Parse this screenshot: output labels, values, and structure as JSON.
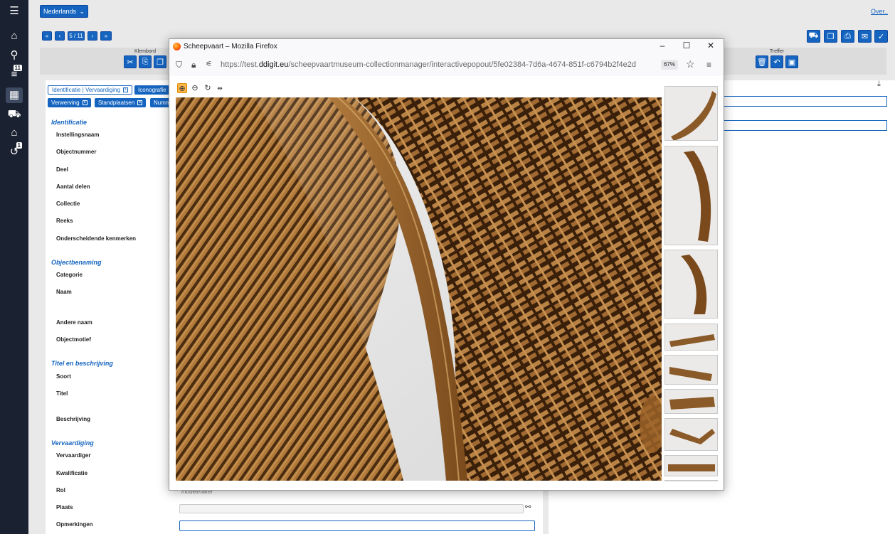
{
  "topbar": {
    "language": "Nederlands",
    "over_link": "Over.."
  },
  "leftnav": {
    "badge_list": "11",
    "badge_history": "1"
  },
  "pager": {
    "first": "«",
    "prev": "‹",
    "position": "5 / 11",
    "next": "›",
    "last": "»"
  },
  "toolbar": {
    "klembord_label": "Klembord",
    "treffer_label": "Treffer"
  },
  "tabs": {
    "row1": [
      {
        "label": "Identificatie | Vervaardiging",
        "active": false
      },
      {
        "label": "Iconografie",
        "active": true
      }
    ],
    "row2": [
      {
        "label": "Verwerving",
        "active": true
      },
      {
        "label": "Standplaatsen",
        "active": true
      },
      {
        "label": "Numm",
        "active": true
      }
    ]
  },
  "form": {
    "sec_identificatie": "Identificatie",
    "instellingsnaam": "Instellingsnaam",
    "objectnummer": "Objectnummer",
    "deel": "Deel",
    "aantal_delen": "Aantal delen",
    "collectie": "Collectie",
    "reeks": "Reeks",
    "onderscheidende": "Onderscheidende kenmerken",
    "sec_objectbenaming": "Objectbenaming",
    "categorie": "Categorie",
    "naam": "Naam",
    "andere_naam": "Andere naam",
    "objectmotief": "Objectmotief",
    "sec_titel": "Titel en beschrijving",
    "soort": "Soort",
    "titel": "Titel",
    "beschrijving": "Beschrijving",
    "sec_vervaardiging": "Vervaardiging",
    "vervaardiger": "Vervaardiger",
    "kwalificatie": "Kwalificatie",
    "rol": "Rol",
    "rol_value": "modelmaker",
    "plaats": "Plaats",
    "opmerkingen": "Opmerkingen"
  },
  "popup": {
    "window_title": "Scheepvaart – Mozilla Firefox",
    "url_prefix": "https://test.",
    "url_domain": "ddigit.eu",
    "url_path": "/scheepvaartmuseum-collectionmanager/interactivepopout/5fe02384-7d6a-4674-851f-c6794b2f4e2d",
    "zoom": "67%",
    "thumbnail_count": 9
  },
  "icons": [
    "menu-icon",
    "home-icon",
    "search-icon",
    "list-icon",
    "grid-icon",
    "cart-icon",
    "history-icon",
    "firefox-logo-icon",
    "shield-icon",
    "lock-icon",
    "permissions-icon",
    "star-icon",
    "hamburger-icon",
    "zoom-in-icon",
    "zoom-out-icon",
    "rotate-icon",
    "fit-width-icon",
    "link-icon",
    "download-icon"
  ],
  "colors": {
    "nav_bg": "#1a2130",
    "accent": "#1565c0",
    "section_title": "#1565c0",
    "wood": "#8a5a28"
  }
}
